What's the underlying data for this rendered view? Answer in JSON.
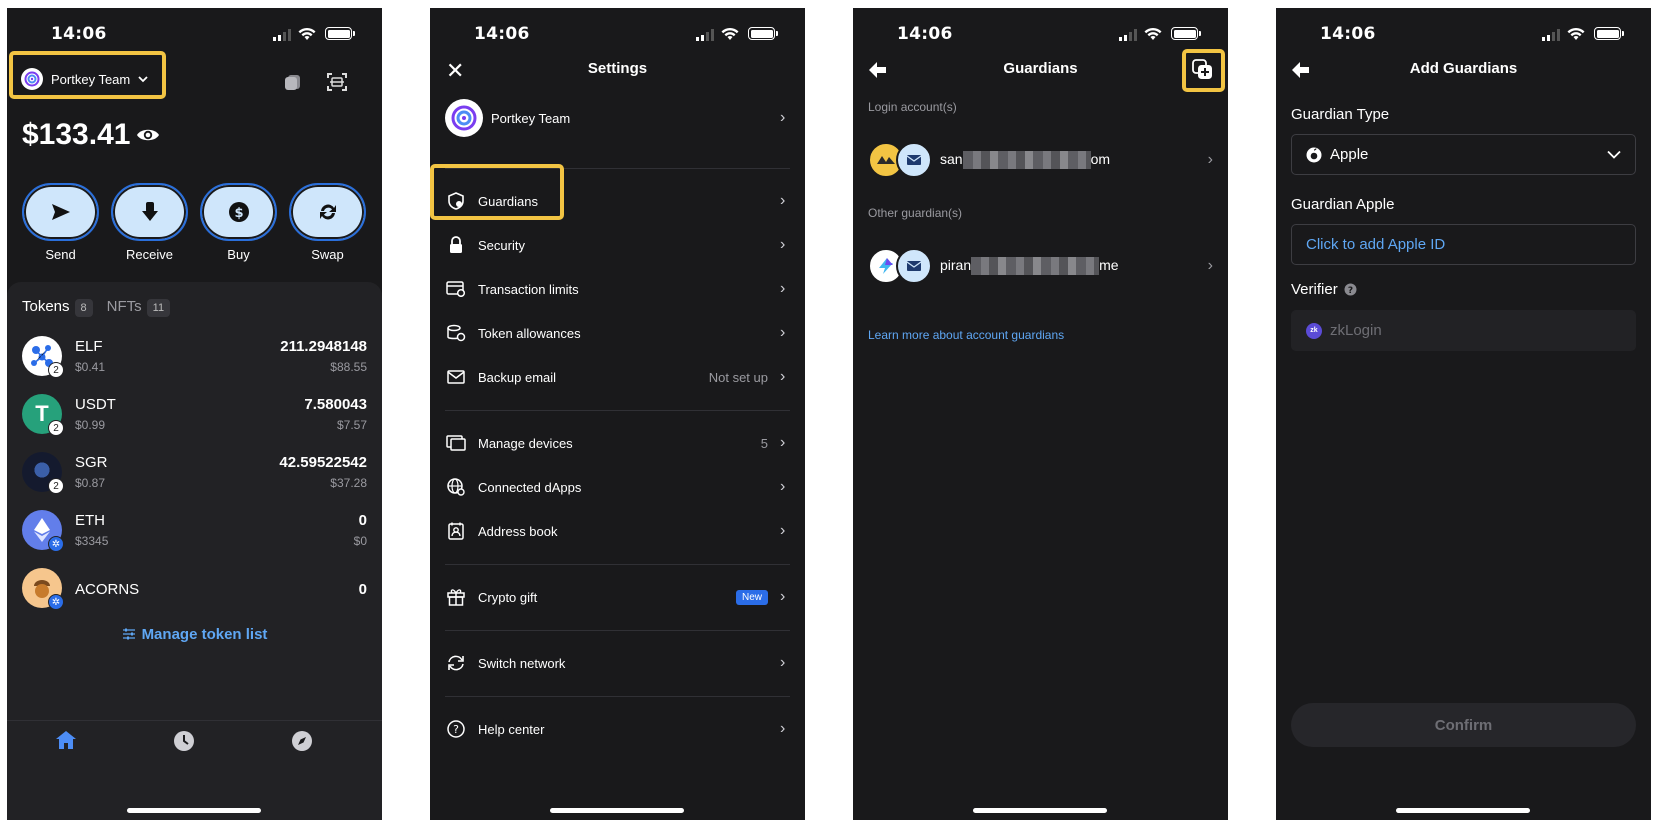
{
  "status": {
    "time": "14:06"
  },
  "home": {
    "account_name": "Portkey Team",
    "balance": "$133.41",
    "actions": [
      {
        "label": "Send",
        "icon": "send-icon"
      },
      {
        "label": "Receive",
        "icon": "receive-icon"
      },
      {
        "label": "Buy",
        "icon": "buy-icon"
      },
      {
        "label": "Swap",
        "icon": "swap-icon"
      }
    ],
    "tabs": [
      {
        "label": "Tokens",
        "count": "8"
      },
      {
        "label": "NFTs",
        "count": "11"
      }
    ],
    "tokens": [
      {
        "symbol": "ELF",
        "price": "$0.41",
        "amount": "211.2948148",
        "value": "$88.55",
        "chain": "2"
      },
      {
        "symbol": "USDT",
        "price": "$0.99",
        "amount": "7.580043",
        "value": "$7.57",
        "chain": "2"
      },
      {
        "symbol": "SGR",
        "price": "$0.87",
        "amount": "42.59522542",
        "value": "$37.28",
        "chain": "2"
      },
      {
        "symbol": "ETH",
        "price": "$3345",
        "amount": "0",
        "value": "$0",
        "chain": ""
      },
      {
        "symbol": "ACORNS",
        "price": "",
        "amount": "0",
        "value": "",
        "chain": ""
      }
    ],
    "manage_label": "Manage token list"
  },
  "settings": {
    "title": "Settings",
    "profile_name": "Portkey Team",
    "items": [
      {
        "label": "Guardians",
        "value": ""
      },
      {
        "label": "Security",
        "value": ""
      },
      {
        "label": "Transaction limits",
        "value": ""
      },
      {
        "label": "Token allowances",
        "value": ""
      },
      {
        "label": "Backup email",
        "value": "Not set up"
      },
      {
        "label": "Manage devices",
        "value": "5"
      },
      {
        "label": "Connected dApps",
        "value": ""
      },
      {
        "label": "Address book",
        "value": ""
      },
      {
        "label": "Crypto gift",
        "value": "New"
      },
      {
        "label": "Switch network",
        "value": ""
      },
      {
        "label": "Help center",
        "value": ""
      }
    ]
  },
  "guardians": {
    "title": "Guardians",
    "login_section": "Login account(s)",
    "login_prefix": "san",
    "login_suffix": "om",
    "other_section": "Other guardian(s)",
    "other_prefix": "piran",
    "other_suffix": "me",
    "learn_more": "Learn more about account guardians"
  },
  "add_guardians": {
    "title": "Add Guardians",
    "type_label": "Guardian Type",
    "type_value": "Apple",
    "apple_label": "Guardian Apple",
    "apple_placeholder": "Click to add Apple ID",
    "verifier_label": "Verifier",
    "verifier_value": "zkLogin",
    "confirm_label": "Confirm"
  },
  "colors": {
    "background": "#19191b",
    "highlight": "#f2c443",
    "accent": "#5fa7f4",
    "action_fill": "#cfe6fb"
  }
}
